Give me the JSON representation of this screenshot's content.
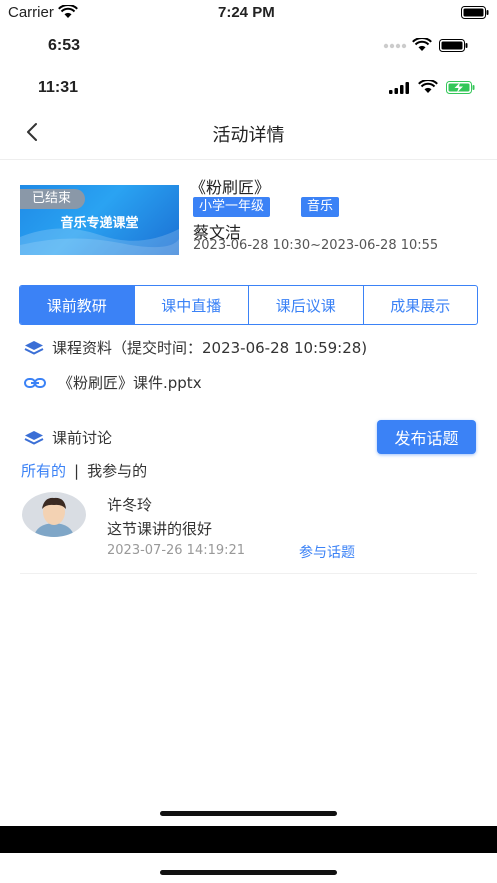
{
  "status_bars": {
    "carrier": "Carrier",
    "time_outer": "7:24 PM",
    "time_middle": "6:53",
    "time_inner": "11:31"
  },
  "nav": {
    "title": "活动详情"
  },
  "activity": {
    "thumb_badge": "已结束",
    "thumb_title": "音乐专递课堂",
    "title": "《粉刷匠》",
    "tags": [
      "小学一年级",
      "音乐"
    ],
    "teacher": "蔡文洁",
    "time_range": "2023-06-28 10:30~2023-06-28 10:55"
  },
  "tabs": [
    {
      "label": "课前教研",
      "active": true
    },
    {
      "label": "课中直播",
      "active": false
    },
    {
      "label": "课后议课",
      "active": false
    },
    {
      "label": "成果展示",
      "active": false
    }
  ],
  "materials": {
    "heading": "课程资料（提交时间：2023-06-28 10:59:28)",
    "file": "《粉刷匠》课件.pptx"
  },
  "discussion": {
    "heading": "课前讨论",
    "publish_label": "发布话题",
    "filter_all": "所有的",
    "filter_sep": "|",
    "filter_mine": "我参与的",
    "comments": [
      {
        "name": "许冬玲",
        "text": "这节课讲的很好",
        "time": "2023-07-26 14:19:21",
        "action": "参与话题"
      }
    ]
  },
  "colors": {
    "accent": "#3b82f6",
    "battery_green": "#34c759"
  }
}
